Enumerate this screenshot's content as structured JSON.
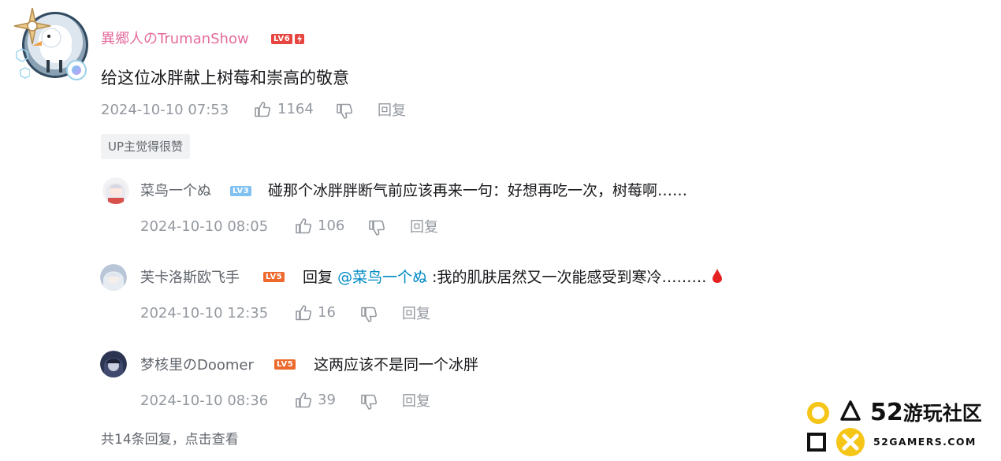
{
  "main_comment": {
    "username": "異郷人のTrumanShow",
    "level": "LV6",
    "text": "给这位冰胖献上树莓和崇高的敬意",
    "date": "2024-10-10 07:53",
    "likes": "1164",
    "reply_label": "回复",
    "up_tag": "UP主觉得很赞"
  },
  "replies": [
    {
      "username": "菜鸟一个ぬ",
      "level": "LV3",
      "text": "碰那个冰胖胖断气前应该再来一句：好想再吃一次，树莓啊……",
      "date": "2024-10-10 08:05",
      "likes": "106",
      "reply_label": "回复"
    },
    {
      "username": "芙卡洛斯欧飞手",
      "level": "LV5",
      "reply_prefix": "回复",
      "mention": "@菜鸟一个ぬ",
      "text": ":我的肌肤居然又一次能感受到寒冷………",
      "date": "2024-10-10 12:35",
      "likes": "16",
      "reply_label": "回复"
    },
    {
      "username": "梦核里のDoomer",
      "level": "LV5",
      "text": "这两应该不是同一个冰胖",
      "date": "2024-10-10 08:36",
      "likes": "39",
      "reply_label": "回复"
    }
  ],
  "view_more": "共14条回复，点击查看",
  "watermark": {
    "cn": "52游玩社区",
    "num": "52",
    "name": "游玩社区",
    "en": "52GAMERS.COM"
  },
  "colors": {
    "username_main": "#e46c9c",
    "mention": "#008ac5",
    "meta": "#9499a0",
    "watermark_yellow": "#f5c518"
  }
}
